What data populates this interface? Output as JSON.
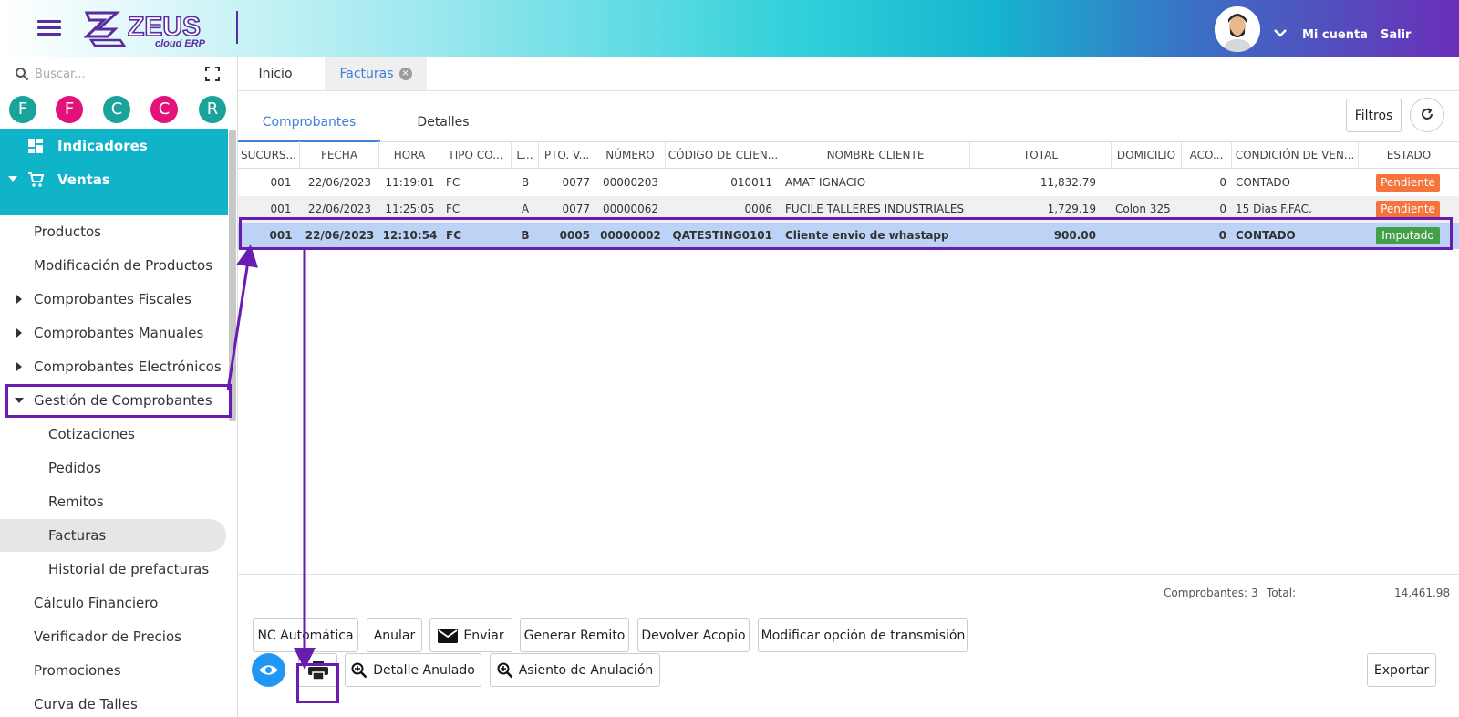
{
  "header": {
    "logo_text": "ZEUS",
    "logo_sub": "cloud ERP",
    "account_label": "Mi cuenta",
    "logout_label": "Salir",
    "brand_color": "#5a2ca0"
  },
  "sidebar": {
    "search_placeholder": "Buscar...",
    "quick_access": [
      {
        "letter": "F",
        "color": "#1aa39a"
      },
      {
        "letter": "F",
        "color": "#e3127a"
      },
      {
        "letter": "C",
        "color": "#1aa39a"
      },
      {
        "letter": "C",
        "color": "#e3127a"
      },
      {
        "letter": "R",
        "color": "#1aa39a"
      }
    ],
    "top_items": [
      {
        "label": "Indicadores",
        "icon": "dashboard-icon"
      },
      {
        "label": "Ventas",
        "icon": "cart-icon"
      }
    ],
    "items": [
      {
        "label": "Productos"
      },
      {
        "label": "Modificación de Productos"
      },
      {
        "label": "Comprobantes Fiscales"
      },
      {
        "label": "Comprobantes Manuales"
      },
      {
        "label": "Comprobantes Electrónicos"
      },
      {
        "label": "Gestión de Comprobantes"
      },
      {
        "label": "Cotizaciones"
      },
      {
        "label": "Pedidos"
      },
      {
        "label": "Remitos"
      },
      {
        "label": "Facturas"
      },
      {
        "label": "Historial de prefacturas"
      },
      {
        "label": "Cálculo Financiero"
      },
      {
        "label": "Verificador de Precios"
      },
      {
        "label": "Promociones"
      },
      {
        "label": "Curva de Talles"
      }
    ]
  },
  "tabs": {
    "home": "Inicio",
    "facturas": "Facturas",
    "close_glyph": "×"
  },
  "subtabs": {
    "comprobantes": "Comprobantes",
    "detalles": "Detalles"
  },
  "toolbar": {
    "filtros": "Filtros"
  },
  "table": {
    "columns": [
      "SUCURS...",
      "FECHA",
      "HORA",
      "TIPO CO...",
      "L...",
      "PTO. V...",
      "NÚMERO",
      "CÓDIGO DE CLIEN...",
      "NOMBRE CLIENTE",
      "TOTAL",
      "DOMICILIO",
      "ACO...",
      "CONDICIÓN DE VEN...",
      "ESTADO"
    ],
    "rows": [
      {
        "sucursal": "001",
        "fecha": "22/06/2023",
        "hora": "11:19:01",
        "tipo": "FC",
        "letra": "B",
        "pto": "0077",
        "numero": "00000203",
        "codigo": "010011",
        "nombre": "AMAT IGNACIO",
        "total": "11,832.79",
        "domicilio": "",
        "acopio": "0",
        "condicion": "CONTADO",
        "estado": "Pendiente"
      },
      {
        "sucursal": "001",
        "fecha": "22/06/2023",
        "hora": "11:25:05",
        "tipo": "FC",
        "letra": "A",
        "pto": "0077",
        "numero": "00000062",
        "codigo": "0006",
        "nombre": "FUCILE TALLERES INDUSTRIALES",
        "total": "1,729.19",
        "domicilio": "Colon 325",
        "acopio": "0",
        "condicion": "15 Dias F.FAC.",
        "estado": "Pendiente"
      },
      {
        "sucursal": "001",
        "fecha": "22/06/2023",
        "hora": "12:10:54",
        "tipo": "FC",
        "letra": "B",
        "pto": "0005",
        "numero": "00000002",
        "codigo": "QATESTING0101",
        "nombre": "Cliente envio de whastapp",
        "total": "900.00",
        "domicilio": "",
        "acopio": "0",
        "condicion": "CONTADO",
        "estado": "Imputado"
      }
    ],
    "status_colors": {
      "pendiente": "#f4743b",
      "imputado": "#43a047"
    }
  },
  "totals": {
    "count_label": "Comprobantes:",
    "count_value": "3",
    "total_label": "Total:",
    "total_value": "14,461.98"
  },
  "actions": {
    "nc_automatica": "NC Automática",
    "anular": "Anular",
    "enviar": "Enviar",
    "generar_remito": "Generar Remito",
    "devolver_acopio": "Devolver Acopio",
    "modificar_transmision": "Modificar opción de transmisión",
    "detalle_anulado": "Detalle Anulado",
    "asiento_anulacion": "Asiento de Anulación",
    "exportar": "Exportar"
  }
}
